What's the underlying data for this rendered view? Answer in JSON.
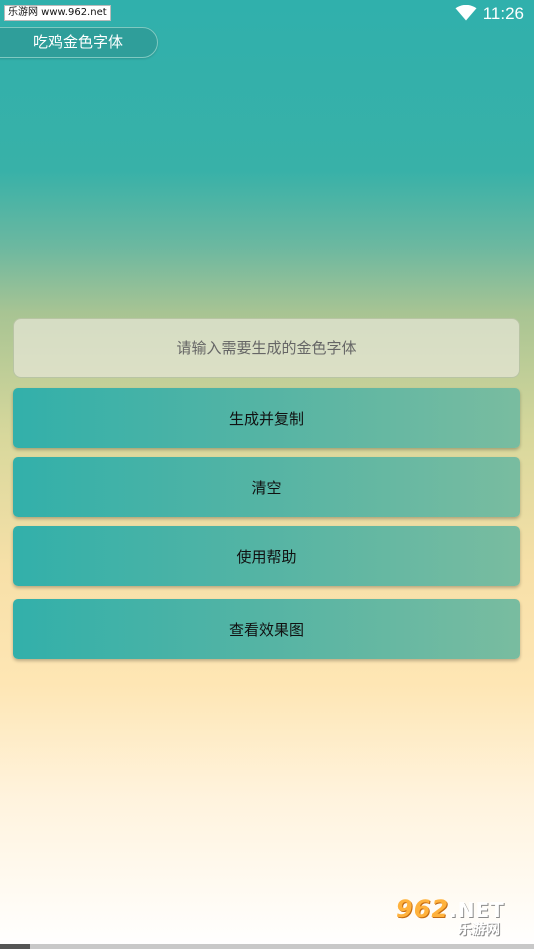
{
  "status_bar": {
    "watermark": "乐游网 www.962.net",
    "time": "11:26",
    "wifi_icon": "wifi-icon"
  },
  "app": {
    "title": "吃鸡金色字体"
  },
  "input": {
    "placeholder": "请输入需要生成的金色字体",
    "value": ""
  },
  "buttons": {
    "generate": "生成并复制",
    "clear": "清空",
    "help": "使用帮助",
    "preview": "查看效果图"
  },
  "watermark_logo": {
    "number": "962",
    "suffix": ".NET",
    "name": "乐游网"
  },
  "colors": {
    "accent": "#32b0aa",
    "title_chip": "#2f9e9a",
    "background_top": "#30b0ac",
    "background_mid": "#fee6b4",
    "background_bottom": "#ffffff"
  }
}
